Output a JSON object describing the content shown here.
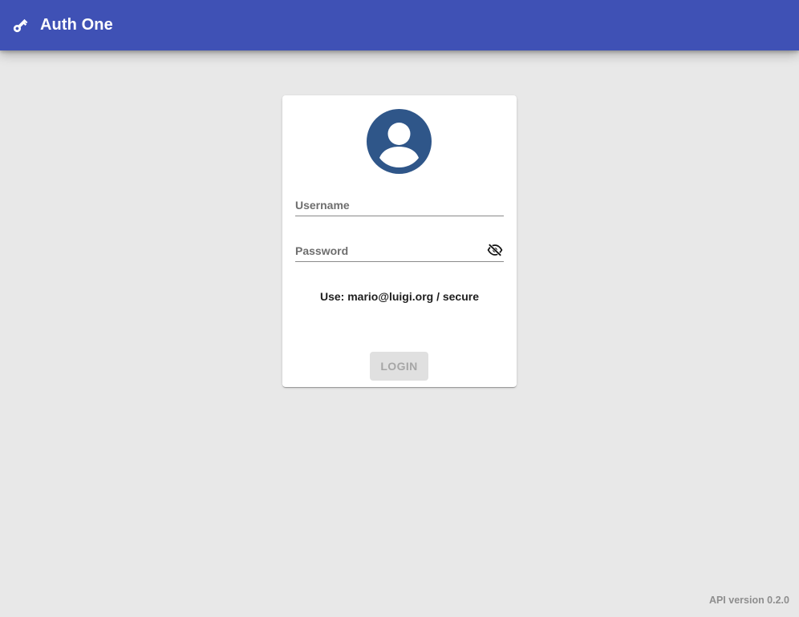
{
  "header": {
    "app_title": "Auth One",
    "icon": "key-icon",
    "background_color": "#3f51b5"
  },
  "login_card": {
    "avatar_icon": "account-circle-icon",
    "avatar_color": "#2f5689",
    "username": {
      "placeholder": "Username",
      "value": ""
    },
    "password": {
      "placeholder": "Password",
      "value": "",
      "toggle_icon": "eye-off-icon"
    },
    "hint": "Use: mario@luigi.org / secure",
    "login_label": "LOGIN"
  },
  "footer": {
    "api_version": "API version 0.2.0"
  }
}
